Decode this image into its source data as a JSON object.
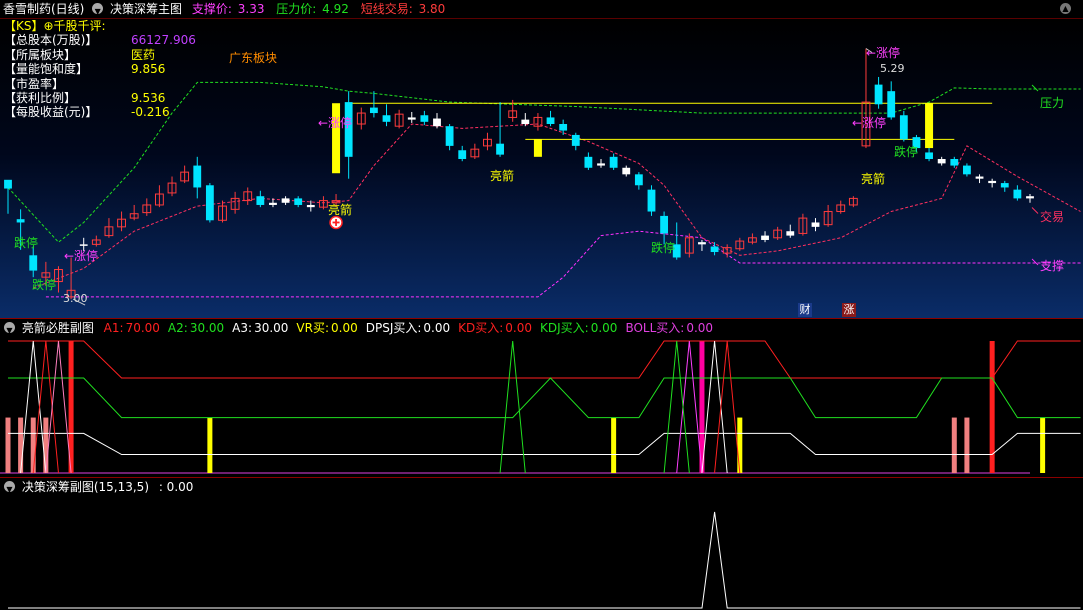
{
  "window": {
    "stock_name": "香雪制药(日线)",
    "indicator_name": "决策深筹主图",
    "support_label": "支撑价:",
    "support_value": "3.33",
    "pressure_label": "压力价:",
    "pressure_value": "4.92",
    "short_label": "短线交易:",
    "short_value": "3.80"
  },
  "info_panel": {
    "header": "【KS】",
    "header_note": "⊕千股千评:",
    "rows": [
      {
        "label": "【总股本(万股)】",
        "value": "66127.906"
      },
      {
        "label": "【所属板块】",
        "value": "医药"
      },
      {
        "label": "【量能饱和度】",
        "value": "9.856"
      },
      {
        "label": "【市盈率】",
        "value": ""
      },
      {
        "label": "【获利比例】",
        "value": "9.536"
      },
      {
        "label": "【每股收益(元)】",
        "value": "-0.216"
      }
    ],
    "sector": "广东板块"
  },
  "annotations": {
    "zhangting": "←涨停",
    "dieting": "跌停",
    "liangjian": "亮箭",
    "price_low": "3.00",
    "price_high": "5.29",
    "pressure": "压力",
    "trade": "交易",
    "support": "支撑",
    "badge_cai": "财",
    "badge_zhang": "涨"
  },
  "sub1": {
    "name": "亮箭必胜副图",
    "items": [
      {
        "label": "A1:",
        "value": "70.00",
        "color": "#ff2020"
      },
      {
        "label": "A2:",
        "value": "30.00",
        "color": "#20e020"
      },
      {
        "label": "A3:",
        "value": "30.00",
        "color": "#ffffff"
      },
      {
        "label": "VR买:",
        "value": "0.00",
        "color": "#ffff00"
      },
      {
        "label": "DPSJ买入:",
        "value": "0.00",
        "color": "#ffffff"
      },
      {
        "label": "KD买入:",
        "value": "0.00",
        "color": "#ff2020"
      },
      {
        "label": "KDJ买入:",
        "value": "0.00",
        "color": "#20e020"
      },
      {
        "label": "BOLL买入:",
        "value": "0.00",
        "color": "#e040e0"
      }
    ]
  },
  "sub2": {
    "name": "决策深筹副图(15,13,5)",
    "value": ": 0.00"
  },
  "colors": {
    "up": "#ff3c3c",
    "down": "#00e5ff",
    "doji": "#ffffff",
    "support": "#ff30ff",
    "pressure": "#20e020",
    "trade": "#ff3060",
    "resistance_line": "#ffff00",
    "cost_line": "#20e020"
  },
  "chart_data": [
    {
      "type": "candlestick",
      "title": "",
      "ylim": [
        2.9,
        5.45
      ],
      "price_labels": {
        "low": 3.0,
        "high": 5.29
      },
      "candles": [
        [
          4.09,
          4.01,
          4.05,
          3.78,
          "down"
        ],
        [
          3.73,
          3.7,
          3.82,
          3.45,
          "down"
        ],
        [
          3.4,
          3.26,
          3.48,
          3.2,
          "down"
        ],
        [
          3.2,
          3.24,
          3.34,
          3.12,
          "up"
        ],
        [
          3.16,
          3.27,
          3.3,
          3.06,
          "up"
        ],
        [
          3.08,
          3.02,
          3.38,
          3.0,
          "up"
        ],
        [
          3.5,
          3.5,
          3.56,
          3.44,
          "doji"
        ],
        [
          3.5,
          3.54,
          3.58,
          3.48,
          "up"
        ],
        [
          3.58,
          3.66,
          3.74,
          3.56,
          "up"
        ],
        [
          3.66,
          3.73,
          3.8,
          3.62,
          "up"
        ],
        [
          3.74,
          3.78,
          3.86,
          3.72,
          "up"
        ],
        [
          3.79,
          3.86,
          3.92,
          3.76,
          "up"
        ],
        [
          3.86,
          3.96,
          4.04,
          3.84,
          "up"
        ],
        [
          3.97,
          4.06,
          4.12,
          3.94,
          "up"
        ],
        [
          4.08,
          4.16,
          4.22,
          4.06,
          "up"
        ],
        [
          4.22,
          4.02,
          4.3,
          3.92,
          "down"
        ],
        [
          4.04,
          3.72,
          4.06,
          3.7,
          "down"
        ],
        [
          3.72,
          3.85,
          3.9,
          3.7,
          "up"
        ],
        [
          3.82,
          3.92,
          3.98,
          3.78,
          "up"
        ],
        [
          3.9,
          3.98,
          4.02,
          3.86,
          "up"
        ],
        [
          3.94,
          3.86,
          3.99,
          3.84,
          "down"
        ],
        [
          3.86,
          3.88,
          3.92,
          3.84,
          "doji"
        ],
        [
          3.88,
          3.92,
          3.94,
          3.86,
          "doji"
        ],
        [
          3.92,
          3.86,
          3.94,
          3.84,
          "down"
        ],
        [
          3.86,
          3.84,
          3.9,
          3.8,
          "doji"
        ],
        [
          3.84,
          3.9,
          3.94,
          3.82,
          "up"
        ],
        [
          3.9,
          3.88,
          3.96,
          3.84,
          "up"
        ],
        [
          4.8,
          4.3,
          4.9,
          4.1,
          "down"
        ],
        [
          4.6,
          4.7,
          4.75,
          4.55,
          "up"
        ],
        [
          4.7,
          4.75,
          4.9,
          4.66,
          "down"
        ],
        [
          4.68,
          4.62,
          4.78,
          4.58,
          "down"
        ],
        [
          4.58,
          4.69,
          4.73,
          4.56,
          "up"
        ],
        [
          4.66,
          4.64,
          4.71,
          4.61,
          "doji"
        ],
        [
          4.68,
          4.62,
          4.72,
          4.59,
          "down"
        ],
        [
          4.65,
          4.58,
          4.7,
          4.56,
          "doji"
        ],
        [
          4.58,
          4.4,
          4.6,
          4.36,
          "down"
        ],
        [
          4.36,
          4.28,
          4.4,
          4.26,
          "down"
        ],
        [
          4.3,
          4.37,
          4.42,
          4.28,
          "up"
        ],
        [
          4.46,
          4.4,
          4.52,
          4.36,
          "up"
        ],
        [
          4.42,
          4.32,
          4.8,
          4.3,
          "down"
        ],
        [
          4.66,
          4.72,
          4.82,
          4.62,
          "up"
        ],
        [
          4.64,
          4.6,
          4.7,
          4.58,
          "doji"
        ],
        [
          4.58,
          4.66,
          4.7,
          4.54,
          "up"
        ],
        [
          4.66,
          4.6,
          4.72,
          4.58,
          "down"
        ],
        [
          4.6,
          4.54,
          4.64,
          4.5,
          "down"
        ],
        [
          4.5,
          4.4,
          4.52,
          4.36,
          "down"
        ],
        [
          4.3,
          4.2,
          4.34,
          4.18,
          "down"
        ],
        [
          4.22,
          4.24,
          4.28,
          4.2,
          "doji"
        ],
        [
          4.3,
          4.2,
          4.33,
          4.18,
          "down"
        ],
        [
          4.2,
          4.14,
          4.22,
          4.12,
          "doji"
        ],
        [
          4.14,
          4.04,
          4.16,
          4.0,
          "down"
        ],
        [
          4.0,
          3.8,
          4.04,
          3.76,
          "down"
        ],
        [
          3.76,
          3.6,
          3.8,
          3.5,
          "down"
        ],
        [
          3.5,
          3.38,
          3.7,
          3.36,
          "down"
        ],
        [
          3.42,
          3.56,
          3.6,
          3.38,
          "up"
        ],
        [
          3.5,
          3.52,
          3.54,
          3.44,
          "doji"
        ],
        [
          3.48,
          3.43,
          3.52,
          3.4,
          "down"
        ],
        [
          3.42,
          3.47,
          3.5,
          3.38,
          "up"
        ],
        [
          3.46,
          3.53,
          3.56,
          3.44,
          "up"
        ],
        [
          3.52,
          3.56,
          3.6,
          3.5,
          "up"
        ],
        [
          3.54,
          3.58,
          3.62,
          3.52,
          "doji"
        ],
        [
          3.56,
          3.63,
          3.66,
          3.54,
          "up"
        ],
        [
          3.62,
          3.58,
          3.68,
          3.56,
          "doji"
        ],
        [
          3.6,
          3.74,
          3.78,
          3.58,
          "up"
        ],
        [
          3.66,
          3.7,
          3.74,
          3.62,
          "doji"
        ],
        [
          3.68,
          3.8,
          3.86,
          3.66,
          "up"
        ],
        [
          3.8,
          3.86,
          3.9,
          3.78,
          "up"
        ],
        [
          3.86,
          3.92,
          3.94,
          3.84,
          "up"
        ],
        [
          4.4,
          4.8,
          5.29,
          4.38,
          "up"
        ],
        [
          4.96,
          4.78,
          5.03,
          4.74,
          "down"
        ],
        [
          4.9,
          4.66,
          4.99,
          4.64,
          "down"
        ],
        [
          4.68,
          4.46,
          4.72,
          4.44,
          "down"
        ],
        [
          4.48,
          4.38,
          4.5,
          4.34,
          "down"
        ],
        [
          4.34,
          4.28,
          4.38,
          4.26,
          "down"
        ],
        [
          4.28,
          4.24,
          4.3,
          4.22,
          "doji"
        ],
        [
          4.28,
          4.22,
          4.3,
          4.2,
          "down"
        ],
        [
          4.22,
          4.14,
          4.24,
          4.12,
          "down"
        ],
        [
          4.12,
          4.1,
          4.14,
          4.06,
          "doji"
        ],
        [
          4.08,
          4.06,
          4.1,
          4.02,
          "doji"
        ],
        [
          4.06,
          4.02,
          4.08,
          3.98,
          "down"
        ],
        [
          4.0,
          3.92,
          4.04,
          3.9,
          "down"
        ],
        [
          3.92,
          3.94,
          3.96,
          3.88,
          "doji"
        ]
      ],
      "resistance_segments": [
        {
          "from": 27,
          "to": 78,
          "value": 4.79
        },
        {
          "from": 41,
          "to": 75,
          "value": 4.46
        }
      ],
      "limit_bars": [
        {
          "index": 26,
          "from": 4.79,
          "to": 4.15,
          "color": "#ffff00"
        },
        {
          "index": 42,
          "from": 4.46,
          "to": 4.3,
          "color": "#ffff00"
        },
        {
          "index": 73,
          "from": 4.79,
          "to": 4.38,
          "color": "#ffff00"
        }
      ],
      "pressure_line": [
        [
          0,
          4.02
        ],
        [
          4,
          3.52
        ],
        [
          6,
          3.7
        ],
        [
          10,
          4.2
        ],
        [
          13,
          4.7
        ],
        [
          15,
          4.98
        ],
        [
          20,
          4.98
        ],
        [
          25,
          4.94
        ],
        [
          27,
          4.9
        ],
        [
          29,
          4.88
        ],
        [
          35,
          4.8
        ],
        [
          40,
          4.78
        ],
        [
          45,
          4.76
        ],
        [
          55,
          4.7
        ],
        [
          65,
          4.7
        ],
        [
          70,
          4.7
        ],
        [
          73,
          4.8
        ],
        [
          75,
          4.93
        ],
        [
          78,
          4.92
        ],
        [
          85,
          4.92
        ]
      ],
      "trade_line": [
        [
          2,
          3.1
        ],
        [
          6,
          3.28
        ],
        [
          10,
          3.62
        ],
        [
          15,
          3.85
        ],
        [
          20,
          3.92
        ],
        [
          25,
          3.88
        ],
        [
          27,
          3.9
        ],
        [
          29,
          4.22
        ],
        [
          32,
          4.6
        ],
        [
          36,
          4.56
        ],
        [
          42,
          4.6
        ],
        [
          46,
          4.44
        ],
        [
          50,
          4.24
        ],
        [
          52,
          4.04
        ],
        [
          55,
          3.56
        ],
        [
          58,
          3.4
        ],
        [
          61,
          3.44
        ],
        [
          66,
          3.56
        ],
        [
          70,
          3.8
        ],
        [
          74,
          3.92
        ],
        [
          76,
          4.4
        ],
        [
          80,
          4.12
        ],
        [
          85,
          3.8
        ]
      ],
      "support_line": [
        [
          3,
          3.02
        ],
        [
          15,
          3.02
        ],
        [
          25,
          3.02
        ],
        [
          42,
          3.02
        ],
        [
          44,
          3.2
        ],
        [
          47,
          3.58
        ],
        [
          50,
          3.62
        ],
        [
          55,
          3.56
        ],
        [
          58,
          3.33
        ],
        [
          70,
          3.33
        ],
        [
          85,
          3.33
        ]
      ]
    },
    {
      "type": "line",
      "title": "",
      "ylim": [
        0,
        100
      ],
      "x": [
        0,
        2,
        4,
        6,
        9,
        12,
        15,
        18,
        22,
        25,
        27,
        30,
        33,
        36,
        40,
        43,
        46,
        50,
        52,
        54,
        55,
        56,
        57,
        58,
        59,
        60,
        62,
        64,
        66,
        68,
        70,
        72,
        74,
        76,
        78,
        80,
        82,
        85
      ],
      "series": [
        {
          "name": "A1",
          "color": "#ff2020",
          "values": [
            100,
            100,
            100,
            100,
            72,
            72,
            72,
            72,
            72,
            72,
            72,
            72,
            72,
            72,
            72,
            72,
            72,
            72,
            100,
            100,
            100,
            100,
            100,
            100,
            100,
            100,
            72,
            72,
            72,
            72,
            72,
            72,
            72,
            72,
            72,
            100,
            100,
            100
          ]
        },
        {
          "name": "A2",
          "color": "#20e020",
          "values": [
            72,
            72,
            72,
            72,
            42,
            42,
            42,
            42,
            42,
            42,
            42,
            42,
            42,
            42,
            42,
            72,
            42,
            42,
            72,
            72,
            72,
            72,
            72,
            72,
            72,
            72,
            72,
            42,
            42,
            42,
            42,
            42,
            72,
            72,
            72,
            42,
            42,
            42
          ]
        },
        {
          "name": "A3",
          "color": "#ffffff",
          "values": [
            30,
            30,
            30,
            30,
            14,
            14,
            14,
            14,
            14,
            14,
            14,
            14,
            14,
            14,
            14,
            14,
            14,
            14,
            30,
            30,
            30,
            30,
            30,
            30,
            30,
            30,
            30,
            14,
            14,
            14,
            14,
            14,
            14,
            14,
            14,
            30,
            30,
            30
          ]
        }
      ],
      "spike_bars": [
        {
          "index": 0,
          "value": 42,
          "color": "#f08080"
        },
        {
          "index": 1,
          "value": 42,
          "color": "#f08080"
        },
        {
          "index": 2,
          "value": 42,
          "color": "#f08080"
        },
        {
          "index": 3,
          "value": 42,
          "color": "#f08080"
        },
        {
          "index": 5,
          "value": 100,
          "color": "#ff2020"
        },
        {
          "index": 16,
          "value": 42,
          "color": "#ffff00"
        },
        {
          "index": 48,
          "value": 42,
          "color": "#ffff00"
        },
        {
          "index": 55,
          "value": 100,
          "color": "#ff00a0"
        },
        {
          "index": 58,
          "value": 42,
          "color": "#ffff00"
        },
        {
          "index": 75,
          "value": 42,
          "color": "#f08080"
        },
        {
          "index": 76,
          "value": 42,
          "color": "#f08080"
        },
        {
          "index": 78,
          "value": 100,
          "color": "#ff2020"
        },
        {
          "index": 82,
          "value": 42,
          "color": "#ffff00"
        }
      ]
    },
    {
      "type": "line",
      "title": "",
      "ylim": [
        0,
        100
      ],
      "series": [
        {
          "name": "",
          "color": "#ffffff",
          "values": [
            [
              0,
              0
            ],
            [
              55,
              0
            ],
            [
              56,
              100
            ],
            [
              57,
              0
            ],
            [
              85,
              0
            ]
          ]
        }
      ]
    }
  ]
}
